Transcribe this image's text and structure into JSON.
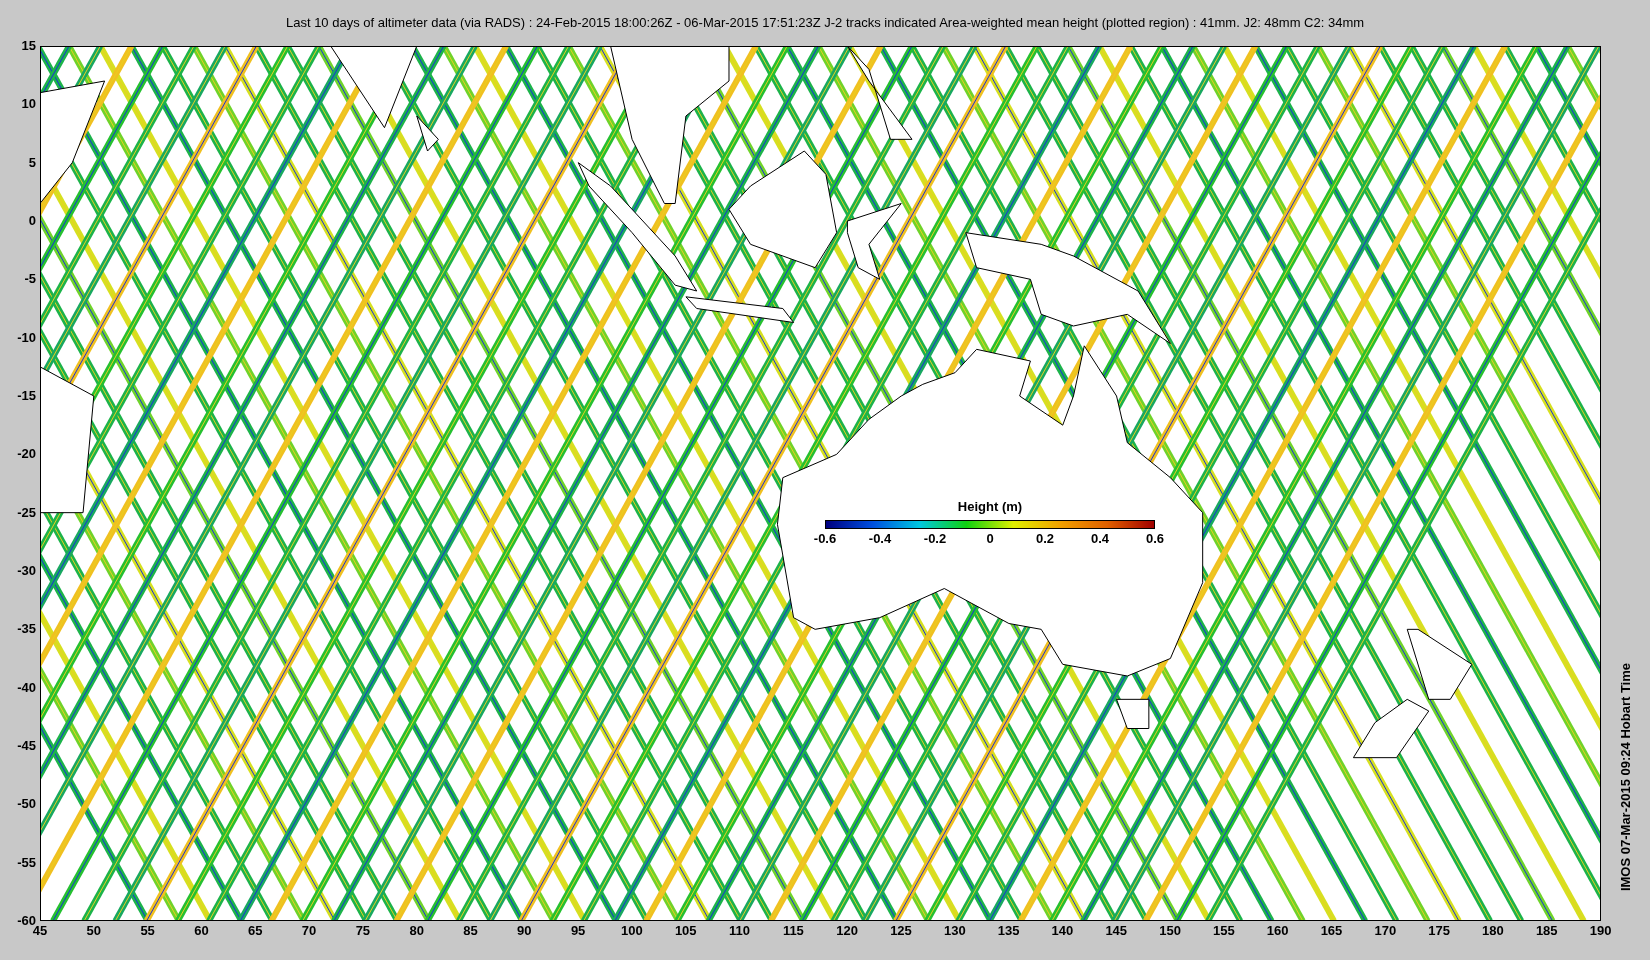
{
  "title": "Last 10 days of altimeter data (via RADS) : 24-Feb-2015 18:00:26Z - 06-Mar-2015 17:51:23Z  J-2 tracks indicated  Area-weighted mean height (plotted region) : 41mm.  J2: 48mm  C2: 34mm",
  "y_ticks": [
    "15",
    "10",
    "5",
    "0",
    "-5",
    "-10",
    "-15",
    "-20",
    "-25",
    "-30",
    "-35",
    "-40",
    "-45",
    "-50",
    "-55",
    "-60"
  ],
  "x_ticks": [
    "45",
    "50",
    "55",
    "60",
    "65",
    "70",
    "75",
    "80",
    "85",
    "90",
    "95",
    "100",
    "105",
    "110",
    "115",
    "120",
    "125",
    "130",
    "135",
    "140",
    "145",
    "150",
    "155",
    "160",
    "165",
    "170",
    "175",
    "180",
    "185",
    "190"
  ],
  "colorbar": {
    "title": "Height (m)",
    "ticks": [
      "-0.6",
      "-0.4",
      "-0.2",
      "0",
      "0.2",
      "0.4",
      "0.6"
    ]
  },
  "side_note": "IMOS 07-Mar-2015 09:24 Hobart Time"
}
